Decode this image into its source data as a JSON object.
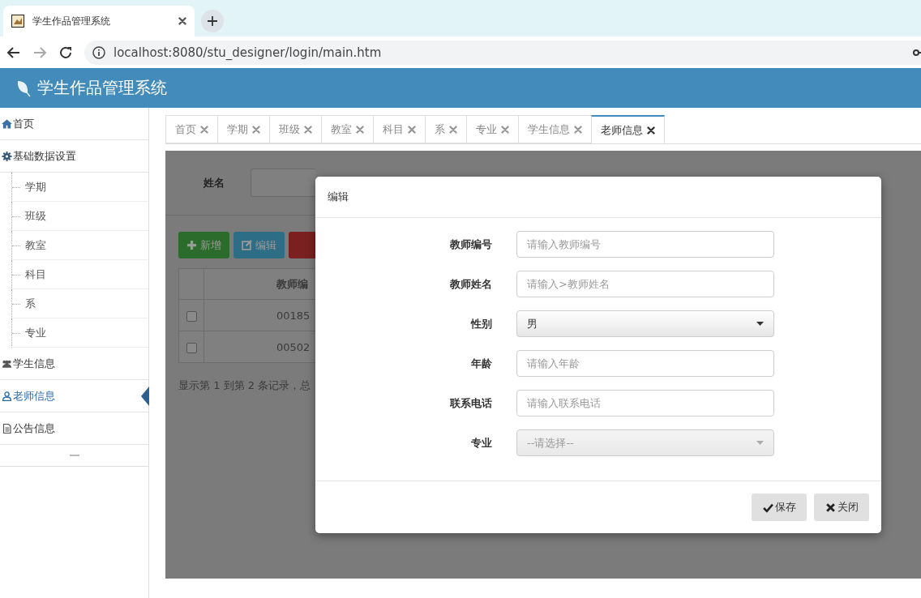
{
  "browser": {
    "tab": {
      "title": "学生作品管理系统"
    },
    "address": "localhost:8080/stu_designer/login/main.htm"
  },
  "app": {
    "title": "学生作品管理系统"
  },
  "sidebar": {
    "items": [
      {
        "label": "首页",
        "kind": "home",
        "selected": false
      },
      {
        "label": "基础数据设置",
        "kind": "settings",
        "selected": false,
        "expanded": true,
        "children": [
          {
            "label": "学期",
            "selected": false
          },
          {
            "label": "班级",
            "selected": false
          },
          {
            "label": "教室",
            "selected": false
          },
          {
            "label": "科目",
            "selected": false
          },
          {
            "label": "系",
            "selected": false
          },
          {
            "label": "专业",
            "selected": false
          }
        ]
      },
      {
        "label": "学生信息",
        "kind": "group",
        "selected": false
      },
      {
        "label": "老师信息",
        "kind": "person",
        "selected": true
      },
      {
        "label": "公告信息",
        "kind": "notice",
        "selected": false
      }
    ]
  },
  "tabs": [
    {
      "label": "首页",
      "selected": false
    },
    {
      "label": "学期",
      "selected": false
    },
    {
      "label": "班级",
      "selected": false
    },
    {
      "label": "教室",
      "selected": false
    },
    {
      "label": "科目",
      "selected": false
    },
    {
      "label": "系",
      "selected": false
    },
    {
      "label": "专业",
      "selected": false
    },
    {
      "label": "学生信息",
      "selected": false
    },
    {
      "label": "老师信息",
      "selected": true
    }
  ],
  "background": {
    "search_label": "姓名",
    "buttons": [
      {
        "label": "新增",
        "kind": "add"
      },
      {
        "label": "编辑",
        "kind": "edit"
      },
      {
        "kind": "delete"
      }
    ],
    "table": {
      "columns": [
        "教师编"
      ],
      "rows": [
        {
          "checked": false,
          "cells": [
            "00185"
          ]
        },
        {
          "checked": false,
          "cells": [
            "00502"
          ]
        }
      ]
    },
    "pagination": "显示第 1 到第 2 条记录，总"
  },
  "modal": {
    "title": "编辑",
    "fields": [
      {
        "label": "教师编号",
        "kind": "text",
        "placeholder": "请输入教师编号"
      },
      {
        "label": "教师姓名",
        "kind": "text",
        "placeholder": "请输入>教师姓名"
      },
      {
        "label": "性别",
        "kind": "select",
        "value": "男",
        "disabled": false
      },
      {
        "label": "年龄",
        "kind": "text",
        "placeholder": "请输入年龄"
      },
      {
        "label": "联系电话",
        "kind": "text",
        "placeholder": "请输入联系电话"
      },
      {
        "label": "专业",
        "kind": "select",
        "value": "--请选择--",
        "disabled": true
      }
    ],
    "buttons": [
      {
        "label": "保存",
        "kind": "save"
      },
      {
        "label": "关闭",
        "kind": "close"
      }
    ]
  }
}
